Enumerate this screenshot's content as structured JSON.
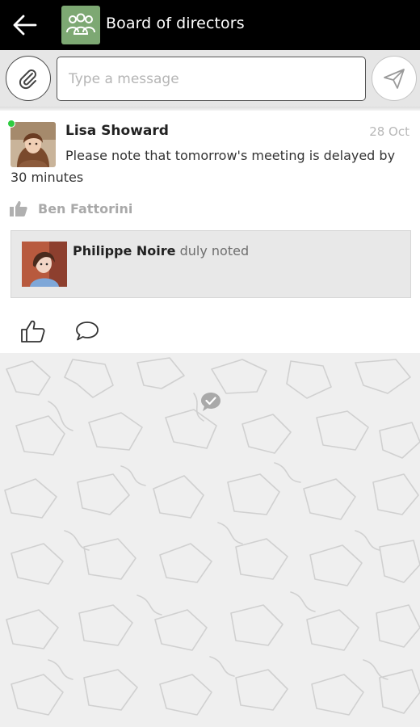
{
  "header": {
    "title": "Board of directors",
    "back_icon": "arrow-left-icon",
    "group_icon": "group-icon",
    "group_color": "#7da873"
  },
  "composer": {
    "placeholder": "Type a message",
    "value": "",
    "attach_icon": "paperclip-icon",
    "send_icon": "send-icon"
  },
  "post": {
    "author": "Lisa Showard",
    "date": "28 Oct",
    "text": "Please note that tomorrow's meeting is delayed by 30 minutes",
    "online": true,
    "online_color": "#2ecc40",
    "liked_by": "Ben Fattorini",
    "like_icon": "thumbs-up-icon"
  },
  "reply": {
    "author": "Philippe Noire",
    "text": "duly noted"
  },
  "actions": {
    "like_icon": "thumbs-up-icon",
    "comment_icon": "comment-bubble-icon"
  },
  "background": {
    "pattern": "racetrack-outline-pattern",
    "end_icon": "chat-check-icon"
  }
}
